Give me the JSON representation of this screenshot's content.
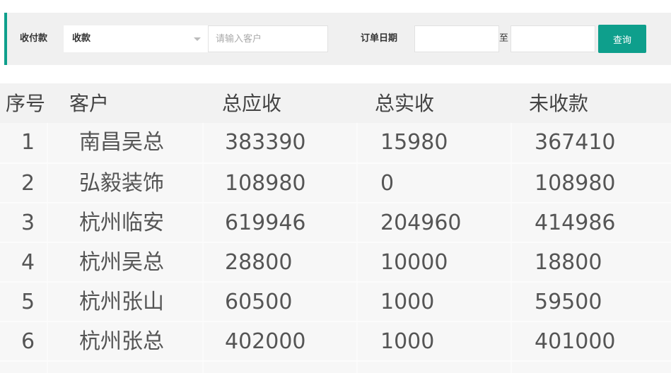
{
  "filters": {
    "payment_type_label": "收付款",
    "payment_type_value": "收款",
    "customer_placeholder": "请输入客户",
    "order_date_label": "订单日期",
    "date_to_label": "至",
    "query_button": "查询"
  },
  "table": {
    "headers": {
      "index": "序号",
      "customer": "客户",
      "total_due": "总应收",
      "total_received": "总实收",
      "unreceived": "未收款"
    },
    "rows": [
      {
        "index": "1",
        "customer": "南昌吴总",
        "total_due": "383390",
        "total_received": "15980",
        "unreceived": "367410"
      },
      {
        "index": "2",
        "customer": "弘毅装饰",
        "total_due": "108980",
        "total_received": "0",
        "unreceived": "108980"
      },
      {
        "index": "3",
        "customer": "杭州临安",
        "total_due": "619946",
        "total_received": "204960",
        "unreceived": "414986"
      },
      {
        "index": "4",
        "customer": "杭州吴总",
        "total_due": "28800",
        "total_received": "10000",
        "unreceived": "18800"
      },
      {
        "index": "5",
        "customer": "杭州张山",
        "total_due": "60500",
        "total_received": "1000",
        "unreceived": "59500"
      },
      {
        "index": "6",
        "customer": "杭州张总",
        "total_due": "402000",
        "total_received": "1000",
        "unreceived": "401000"
      }
    ]
  },
  "colors": {
    "accent": "#0e9f8c",
    "filter_bg": "#f0f0f0",
    "table_bg": "#f7f7f7"
  }
}
